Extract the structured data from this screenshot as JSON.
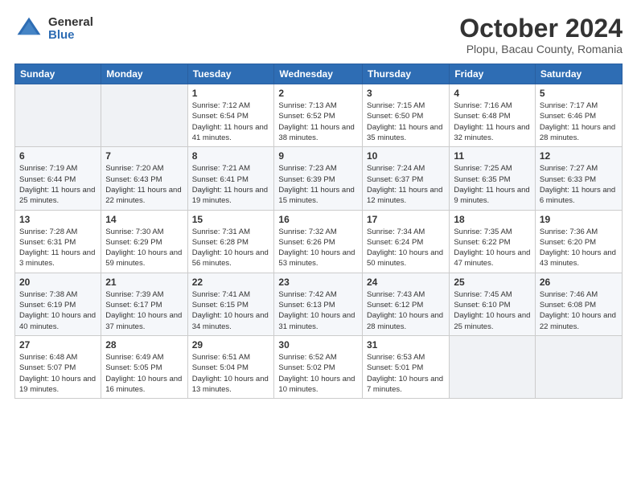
{
  "header": {
    "logo_general": "General",
    "logo_blue": "Blue",
    "month_title": "October 2024",
    "location": "Plopu, Bacau County, Romania"
  },
  "weekdays": [
    "Sunday",
    "Monday",
    "Tuesday",
    "Wednesday",
    "Thursday",
    "Friday",
    "Saturday"
  ],
  "weeks": [
    [
      {
        "day": "",
        "info": ""
      },
      {
        "day": "",
        "info": ""
      },
      {
        "day": "1",
        "info": "Sunrise: 7:12 AM\nSunset: 6:54 PM\nDaylight: 11 hours and 41 minutes."
      },
      {
        "day": "2",
        "info": "Sunrise: 7:13 AM\nSunset: 6:52 PM\nDaylight: 11 hours and 38 minutes."
      },
      {
        "day": "3",
        "info": "Sunrise: 7:15 AM\nSunset: 6:50 PM\nDaylight: 11 hours and 35 minutes."
      },
      {
        "day": "4",
        "info": "Sunrise: 7:16 AM\nSunset: 6:48 PM\nDaylight: 11 hours and 32 minutes."
      },
      {
        "day": "5",
        "info": "Sunrise: 7:17 AM\nSunset: 6:46 PM\nDaylight: 11 hours and 28 minutes."
      }
    ],
    [
      {
        "day": "6",
        "info": "Sunrise: 7:19 AM\nSunset: 6:44 PM\nDaylight: 11 hours and 25 minutes."
      },
      {
        "day": "7",
        "info": "Sunrise: 7:20 AM\nSunset: 6:43 PM\nDaylight: 11 hours and 22 minutes."
      },
      {
        "day": "8",
        "info": "Sunrise: 7:21 AM\nSunset: 6:41 PM\nDaylight: 11 hours and 19 minutes."
      },
      {
        "day": "9",
        "info": "Sunrise: 7:23 AM\nSunset: 6:39 PM\nDaylight: 11 hours and 15 minutes."
      },
      {
        "day": "10",
        "info": "Sunrise: 7:24 AM\nSunset: 6:37 PM\nDaylight: 11 hours and 12 minutes."
      },
      {
        "day": "11",
        "info": "Sunrise: 7:25 AM\nSunset: 6:35 PM\nDaylight: 11 hours and 9 minutes."
      },
      {
        "day": "12",
        "info": "Sunrise: 7:27 AM\nSunset: 6:33 PM\nDaylight: 11 hours and 6 minutes."
      }
    ],
    [
      {
        "day": "13",
        "info": "Sunrise: 7:28 AM\nSunset: 6:31 PM\nDaylight: 11 hours and 3 minutes."
      },
      {
        "day": "14",
        "info": "Sunrise: 7:30 AM\nSunset: 6:29 PM\nDaylight: 10 hours and 59 minutes."
      },
      {
        "day": "15",
        "info": "Sunrise: 7:31 AM\nSunset: 6:28 PM\nDaylight: 10 hours and 56 minutes."
      },
      {
        "day": "16",
        "info": "Sunrise: 7:32 AM\nSunset: 6:26 PM\nDaylight: 10 hours and 53 minutes."
      },
      {
        "day": "17",
        "info": "Sunrise: 7:34 AM\nSunset: 6:24 PM\nDaylight: 10 hours and 50 minutes."
      },
      {
        "day": "18",
        "info": "Sunrise: 7:35 AM\nSunset: 6:22 PM\nDaylight: 10 hours and 47 minutes."
      },
      {
        "day": "19",
        "info": "Sunrise: 7:36 AM\nSunset: 6:20 PM\nDaylight: 10 hours and 43 minutes."
      }
    ],
    [
      {
        "day": "20",
        "info": "Sunrise: 7:38 AM\nSunset: 6:19 PM\nDaylight: 10 hours and 40 minutes."
      },
      {
        "day": "21",
        "info": "Sunrise: 7:39 AM\nSunset: 6:17 PM\nDaylight: 10 hours and 37 minutes."
      },
      {
        "day": "22",
        "info": "Sunrise: 7:41 AM\nSunset: 6:15 PM\nDaylight: 10 hours and 34 minutes."
      },
      {
        "day": "23",
        "info": "Sunrise: 7:42 AM\nSunset: 6:13 PM\nDaylight: 10 hours and 31 minutes."
      },
      {
        "day": "24",
        "info": "Sunrise: 7:43 AM\nSunset: 6:12 PM\nDaylight: 10 hours and 28 minutes."
      },
      {
        "day": "25",
        "info": "Sunrise: 7:45 AM\nSunset: 6:10 PM\nDaylight: 10 hours and 25 minutes."
      },
      {
        "day": "26",
        "info": "Sunrise: 7:46 AM\nSunset: 6:08 PM\nDaylight: 10 hours and 22 minutes."
      }
    ],
    [
      {
        "day": "27",
        "info": "Sunrise: 6:48 AM\nSunset: 5:07 PM\nDaylight: 10 hours and 19 minutes."
      },
      {
        "day": "28",
        "info": "Sunrise: 6:49 AM\nSunset: 5:05 PM\nDaylight: 10 hours and 16 minutes."
      },
      {
        "day": "29",
        "info": "Sunrise: 6:51 AM\nSunset: 5:04 PM\nDaylight: 10 hours and 13 minutes."
      },
      {
        "day": "30",
        "info": "Sunrise: 6:52 AM\nSunset: 5:02 PM\nDaylight: 10 hours and 10 minutes."
      },
      {
        "day": "31",
        "info": "Sunrise: 6:53 AM\nSunset: 5:01 PM\nDaylight: 10 hours and 7 minutes."
      },
      {
        "day": "",
        "info": ""
      },
      {
        "day": "",
        "info": ""
      }
    ]
  ]
}
